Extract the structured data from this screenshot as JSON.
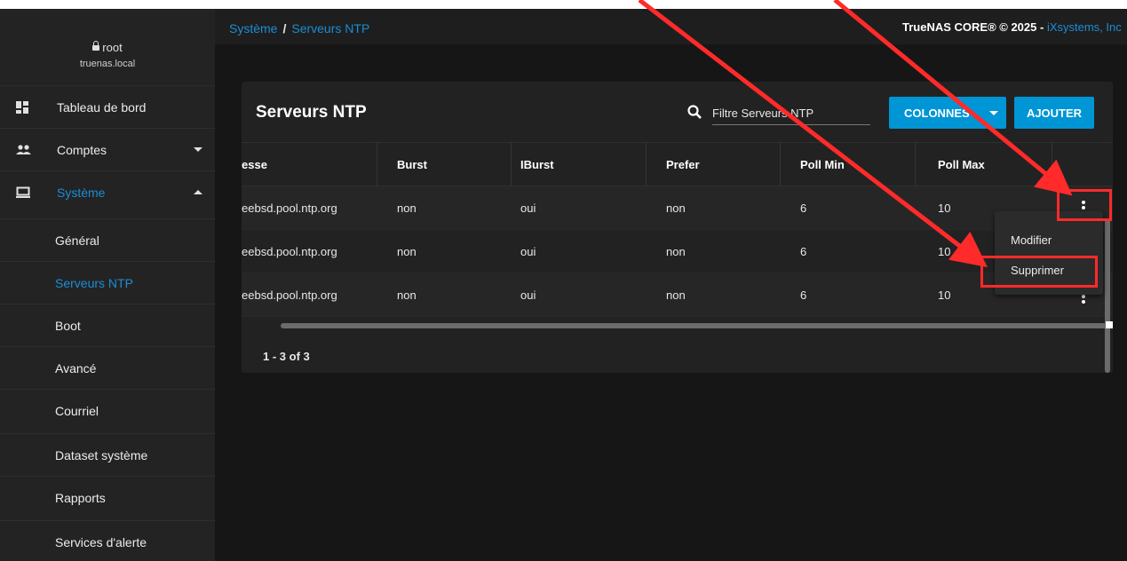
{
  "profile": {
    "user": "root",
    "host": "truenas.local"
  },
  "sidebar": {
    "items": [
      {
        "label": "Tableau de bord",
        "icon": "dashboard-icon"
      },
      {
        "label": "Comptes",
        "icon": "people-icon"
      },
      {
        "label": "Système",
        "icon": "computer-icon"
      }
    ],
    "sub_items": [
      {
        "label": "Général"
      },
      {
        "label": "Serveurs NTP"
      },
      {
        "label": "Boot"
      },
      {
        "label": "Avancé"
      },
      {
        "label": "Courriel"
      },
      {
        "label": "Dataset système"
      },
      {
        "label": "Rapports"
      },
      {
        "label": "Services d'alerte"
      }
    ]
  },
  "breadcrumb": {
    "parent": "Système",
    "separator": "/",
    "current": "Serveurs NTP"
  },
  "copyright": {
    "text": "TrueNAS CORE® © 2025 - ",
    "brand": "iXsystems, Inc"
  },
  "card": {
    "title": "Serveurs NTP",
    "search_placeholder": "Filtre Serveurs NTP",
    "columns_button": "COLONNES",
    "add_button": "AJOUTER"
  },
  "table": {
    "headers": [
      "esse",
      "Burst",
      "IBurst",
      "Prefer",
      "Poll Min",
      "Poll Max"
    ],
    "rows": [
      [
        "eebsd.pool.ntp.org",
        "non",
        "oui",
        "non",
        "6",
        "10"
      ],
      [
        "eebsd.pool.ntp.org",
        "non",
        "oui",
        "non",
        "6",
        "10"
      ],
      [
        "eebsd.pool.ntp.org",
        "non",
        "oui",
        "non",
        "6",
        "10"
      ]
    ],
    "paginator": "1 - 3 of 3"
  },
  "context_menu": {
    "items": [
      {
        "label": "Modifier"
      },
      {
        "label": "Supprimer"
      }
    ]
  },
  "colors": {
    "accent": "#0095d5",
    "link": "#1b8dd6",
    "annotation": "#ff2a2a"
  }
}
